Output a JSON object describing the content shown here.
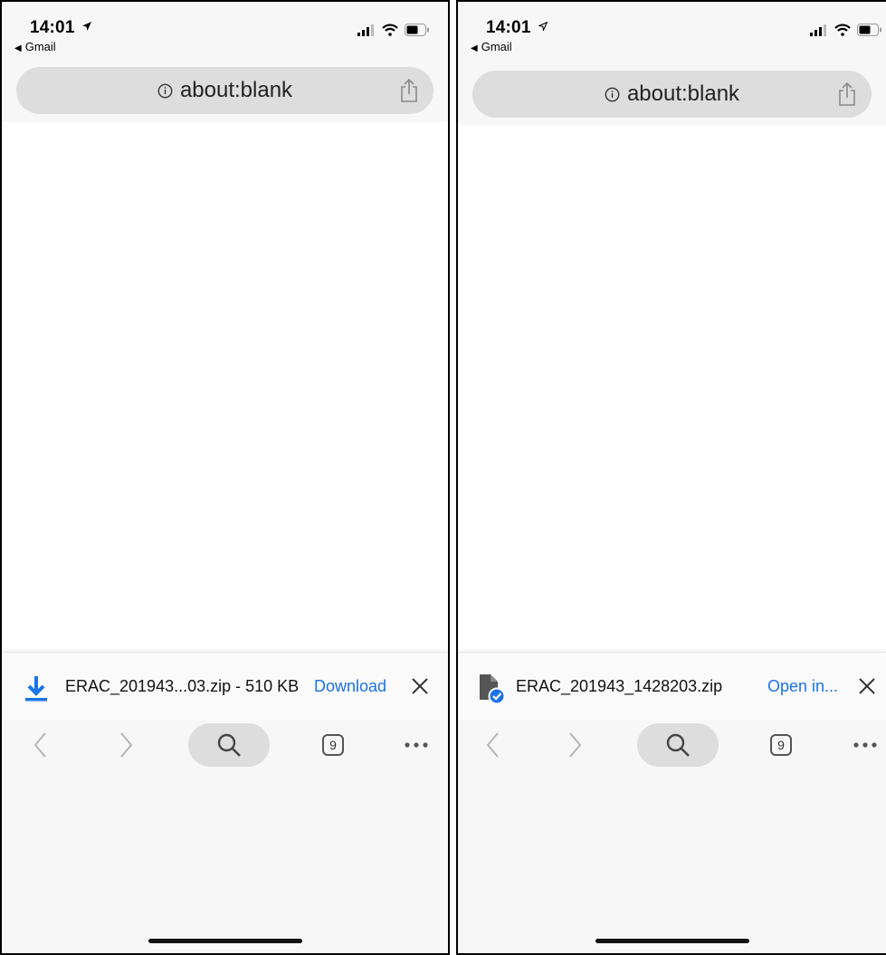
{
  "left": {
    "status": {
      "time": "14:01",
      "back_app": "Gmail"
    },
    "url_bar": {
      "text": "about:blank"
    },
    "download": {
      "file_label": "ERAC_201943...03.zip - 510 KB",
      "action_label": "Download",
      "state": "ready"
    },
    "toolbar": {
      "tab_count": "9"
    }
  },
  "right": {
    "status": {
      "time": "14:01",
      "back_app": "Gmail"
    },
    "url_bar": {
      "text": "about:blank"
    },
    "download": {
      "file_label": "ERAC_201943_1428203.zip",
      "action_label": "Open in...",
      "state": "complete"
    },
    "toolbar": {
      "tab_count": "9"
    }
  },
  "colors": {
    "accent": "#1a73e8",
    "bar_bg": "#dddddd",
    "chrome_bg": "#f7f7f7"
  },
  "icons": [
    "location-arrow-icon",
    "signal-icon",
    "wifi-icon",
    "battery-icon",
    "info-icon",
    "share-icon",
    "download-arrow-icon",
    "file-done-icon",
    "close-icon",
    "back-chevron-icon",
    "forward-chevron-icon",
    "search-icon",
    "tabs-icon",
    "more-icon"
  ]
}
